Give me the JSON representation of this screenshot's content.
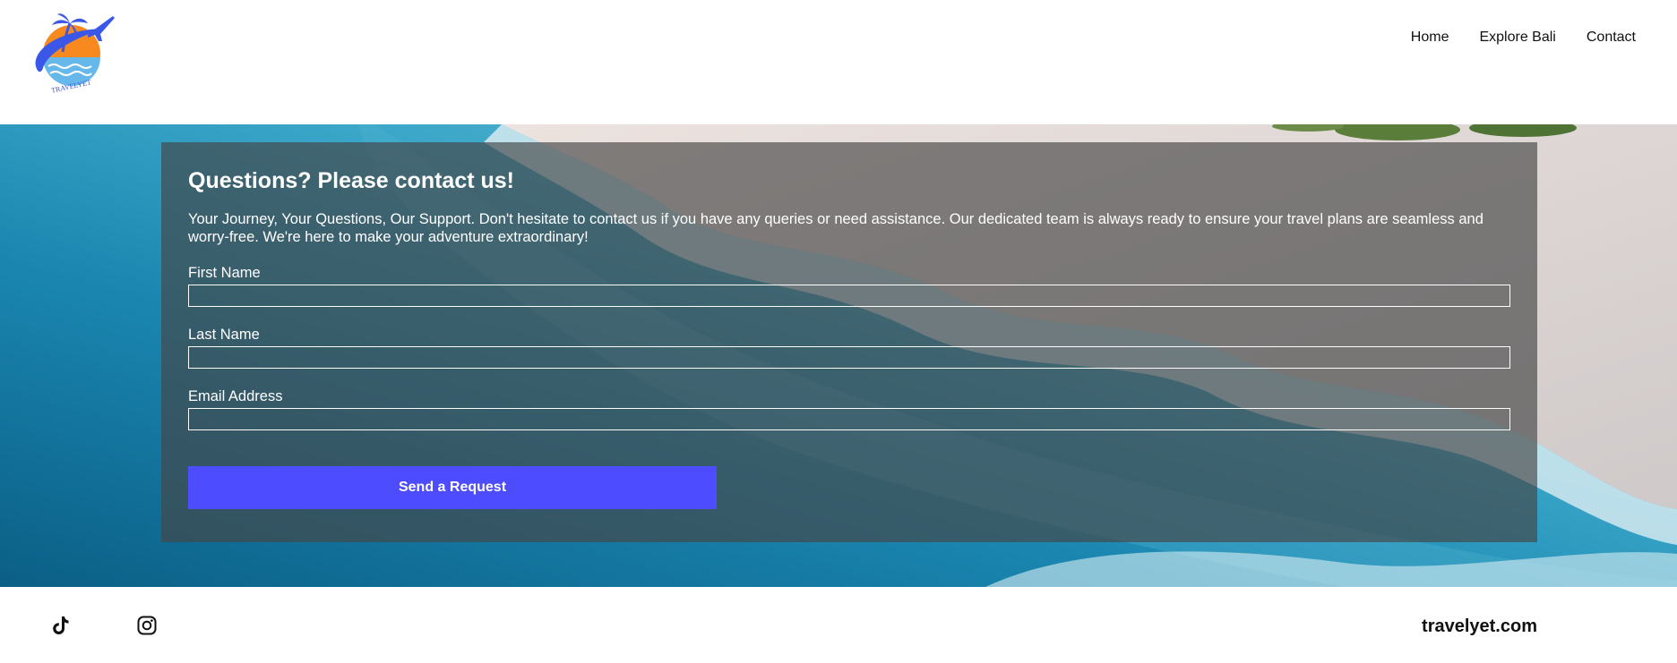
{
  "brand": {
    "logo_text": "TRAVELYET",
    "colors": {
      "orange": "#f7891f",
      "blue": "#3a57e8",
      "light_blue": "#66b8ea"
    }
  },
  "nav": {
    "items": [
      {
        "label": "Home"
      },
      {
        "label": "Explore Bali"
      },
      {
        "label": "Contact"
      }
    ]
  },
  "hero": {
    "background": "aerial beach photo"
  },
  "contact": {
    "title": "Questions? Please contact us!",
    "intro": "Your Journey, Your Questions, Our Support. Don't hesitate to contact us if you have any queries or need assistance. Our dedicated team is always ready to ensure your travel plans are seamless and worry-free. We're here to make your adventure extraordinary!",
    "fields": {
      "first_name": {
        "label": "First Name",
        "value": ""
      },
      "last_name": {
        "label": "Last Name",
        "value": ""
      },
      "email": {
        "label": "Email Address",
        "value": ""
      }
    },
    "submit_label": "Send a Request",
    "submit_color": "#4d4cff"
  },
  "footer": {
    "social": [
      {
        "icon": "tiktok-icon"
      },
      {
        "icon": "instagram-icon"
      }
    ],
    "site": "travelyet.com"
  }
}
